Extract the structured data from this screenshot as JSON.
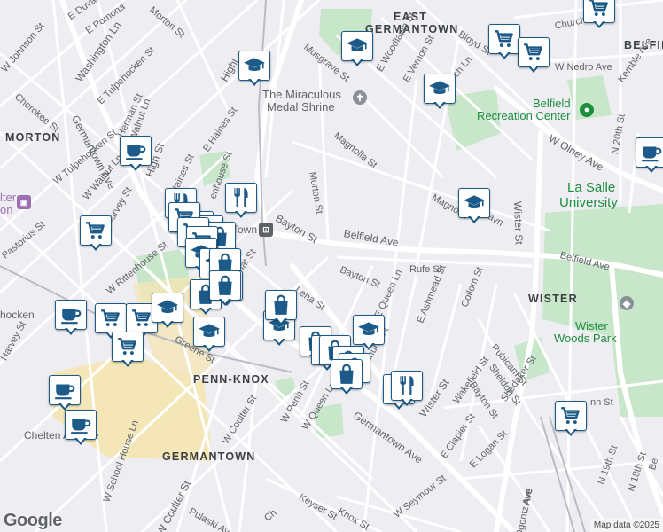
{
  "map": {
    "provider_logo": "Google",
    "attribution": "Map data ©2025",
    "colors": {
      "background": "#eeeef2",
      "road": "#ffffff",
      "park": "#c8e6c9",
      "campus": "#f4e6b6",
      "marker_border": "#1c5a89",
      "marker_icon": "#1c5a89",
      "area_text": "#3c4043",
      "street_text": "#5f6368",
      "green_poi": "#1e8e3e"
    },
    "area_labels": [
      {
        "text": "EAST"
      },
      {
        "text": "GERMANTOWN"
      },
      {
        "text": "BELFIE"
      },
      {
        "text": "MORTON"
      },
      {
        "text": "WISTER"
      },
      {
        "text": "PENN-KNOX"
      },
      {
        "text": "GERMANTOWN"
      }
    ],
    "places": [
      {
        "text": "The Miraculous",
        "icon": "church-icon"
      },
      {
        "text": "Medal Shrine"
      },
      {
        "text": "Belfield",
        "icon": "park-icon"
      },
      {
        "text": "Recreation Center"
      },
      {
        "text": "La Salle"
      },
      {
        "text": "University"
      },
      {
        "text": "Wister",
        "icon": "school-icon"
      },
      {
        "text": "Woods Park"
      },
      {
        "text": "Town",
        "icon": "transit-icon"
      },
      {
        "text": "lter"
      },
      {
        "text": "on",
        "icon": "museum-icon"
      },
      {
        "text": "hocken"
      },
      {
        "text": "Chelten Avenue"
      }
    ],
    "streets": [
      "E Duval St",
      "E Pomona",
      "Morton St",
      "W Johnson St",
      "Washington Ln",
      "E Tulpehocken St",
      "Herman St",
      "Cherokee St",
      "Germantown Ave",
      "W Tulpehocken St",
      "Walnut Ln",
      "High St",
      "W Walnut Ln",
      "Harvey St",
      "Haines St",
      "enhouse St",
      "E Haines St",
      "Highl",
      "Musgrave St",
      "Magnolia St",
      "Morton St",
      "E Woodlawn St",
      "Bloyd St",
      "E Vernon St",
      "Church Ln",
      "W Nedro Ave",
      "Kemble Ave",
      "W Olney Ave",
      "Church",
      "Wister St",
      "N 20th St",
      "Magnolia",
      "Bayn",
      "Bayton St",
      "Belfield Ave",
      "Belfield Ave",
      "Bayton St",
      "Rufe St",
      "W Rittenhouse St",
      "Pastorius St",
      "nat St",
      "Lena St",
      "E Queen Ln",
      "E Ashmead St",
      "Collom St",
      "Rubicam St",
      "Sheldon St",
      "Bayton St",
      "Shedaker St",
      "Harvey St",
      "Greene St",
      "nhurst St",
      "Germantown Ave",
      "Wister St",
      "Wakefield St",
      "E Clapier St",
      "E Logan St",
      "Ogontz Ave",
      "N 19th St",
      "N 18th St",
      "W Penn St",
      "W Queen Ln",
      "W Coulter St",
      "W School House Ln",
      "W Seymour St",
      "Keyser St",
      "Knox St",
      "W Coulter St",
      "Pulaski Ave",
      "Ave",
      "Be",
      "Ch",
      "nn St"
    ],
    "markers": [
      {
        "icon": "shopping-cart-icon"
      },
      {
        "icon": "shopping-cart-icon"
      },
      {
        "icon": "shopping-cart-icon"
      },
      {
        "icon": "graduation-cap-icon"
      },
      {
        "icon": "graduation-cap-icon"
      },
      {
        "icon": "graduation-cap-icon"
      },
      {
        "icon": "coffee-cup-icon"
      },
      {
        "icon": "coffee-cup-icon"
      },
      {
        "icon": "graduation-cap-icon"
      },
      {
        "icon": "shopping-cart-icon"
      },
      {
        "icon": "restaurant-icon"
      },
      {
        "icon": "restaurant-icon"
      },
      {
        "icon": "shopping-bag-icon"
      },
      {
        "icon": "shopping-bag-icon"
      },
      {
        "icon": "shopping-bag-icon"
      },
      {
        "icon": "shopping-bag-icon"
      },
      {
        "icon": "shopping-bag-icon"
      },
      {
        "icon": "shopping-cart-icon"
      },
      {
        "icon": "shopping-cart-icon"
      },
      {
        "icon": "shopping-cart-icon"
      },
      {
        "icon": "graduation-cap-icon"
      },
      {
        "icon": "graduation-cap-icon"
      },
      {
        "icon": "coffee-cup-icon"
      },
      {
        "icon": "shopping-cart-icon"
      },
      {
        "icon": "shopping-cart-icon"
      },
      {
        "icon": "shopping-cart-icon"
      },
      {
        "icon": "graduation-cap-icon"
      },
      {
        "icon": "shopping-bag-icon"
      },
      {
        "icon": "graduation-cap-icon"
      },
      {
        "icon": "shopping-bag-icon"
      },
      {
        "icon": "shopping-bag-icon"
      },
      {
        "icon": "shopping-bag-icon"
      },
      {
        "icon": "graduation-cap-icon"
      },
      {
        "icon": "shopping-bag-icon"
      },
      {
        "icon": "shopping-bag-icon"
      },
      {
        "icon": "restaurant-icon"
      },
      {
        "icon": "restaurant-icon"
      },
      {
        "icon": "coffee-cup-icon"
      },
      {
        "icon": "coffee-cup-icon"
      },
      {
        "icon": "shopping-cart-icon"
      }
    ]
  }
}
